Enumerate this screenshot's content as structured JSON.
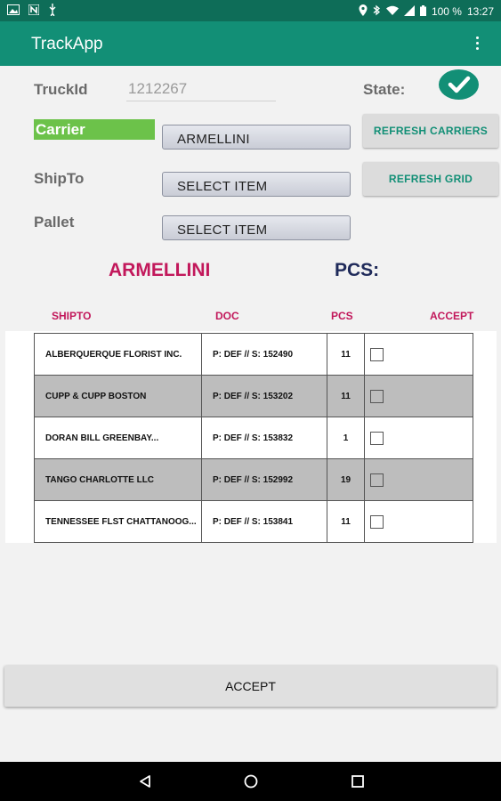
{
  "status_bar": {
    "battery": "100 %",
    "time": "13:27",
    "icons_left": [
      "image-icon",
      "n-icon",
      "usb-icon"
    ],
    "icons_right": [
      "location-icon",
      "bluetooth-icon",
      "wifi-icon",
      "signal-icon",
      "battery-icon"
    ]
  },
  "app_bar": {
    "title": "TrackApp"
  },
  "form": {
    "truck_label": "TruckId",
    "truck_value": "1212267",
    "state_label": "State:",
    "state_icon": "check-circle-icon",
    "carrier_label": "Carrier",
    "carrier_value": "ARMELLINI",
    "shipto_label": "ShipTo",
    "shipto_value": "SELECT ITEM",
    "pallet_label": "Pallet",
    "pallet_value": "SELECT ITEM",
    "refresh_carriers": "REFRESH CARRIERS",
    "refresh_grid": "REFRESH GRID"
  },
  "summary": {
    "carrier": "ARMELLINI",
    "pcs_label": "PCS:"
  },
  "grid": {
    "headers": {
      "shipto": "SHIPTO",
      "doc": "DOC",
      "pcs": "PCS",
      "accept": "ACCEPT"
    },
    "rows": [
      {
        "shipto": "ALBERQUERQUE FLORIST INC.",
        "doc": "P: DEF // S: 152490",
        "pcs": "11",
        "checked": false
      },
      {
        "shipto": "CUPP & CUPP BOSTON",
        "doc": "P: DEF // S: 153202",
        "pcs": "11",
        "checked": false
      },
      {
        "shipto": "DORAN BILL GREENBAY...",
        "doc": "P: DEF // S: 153832",
        "pcs": "1",
        "checked": false
      },
      {
        "shipto": "TANGO CHARLOTTE LLC",
        "doc": "P: DEF // S: 152992",
        "pcs": "19",
        "checked": false
      },
      {
        "shipto": "TENNESSEE FLST CHATTANOOG...",
        "doc": "P: DEF // S: 153841",
        "pcs": "11",
        "checked": false
      }
    ]
  },
  "accept_button": "ACCEPT",
  "colors": {
    "primary": "#128f76",
    "primary_dark": "#0e6d58",
    "carrier_highlight": "#6cc24a",
    "accent_pink": "#c2185b",
    "pcs_navy": "#1f2a5a"
  },
  "nav_bar": [
    "back-icon",
    "home-icon",
    "recents-icon"
  ]
}
